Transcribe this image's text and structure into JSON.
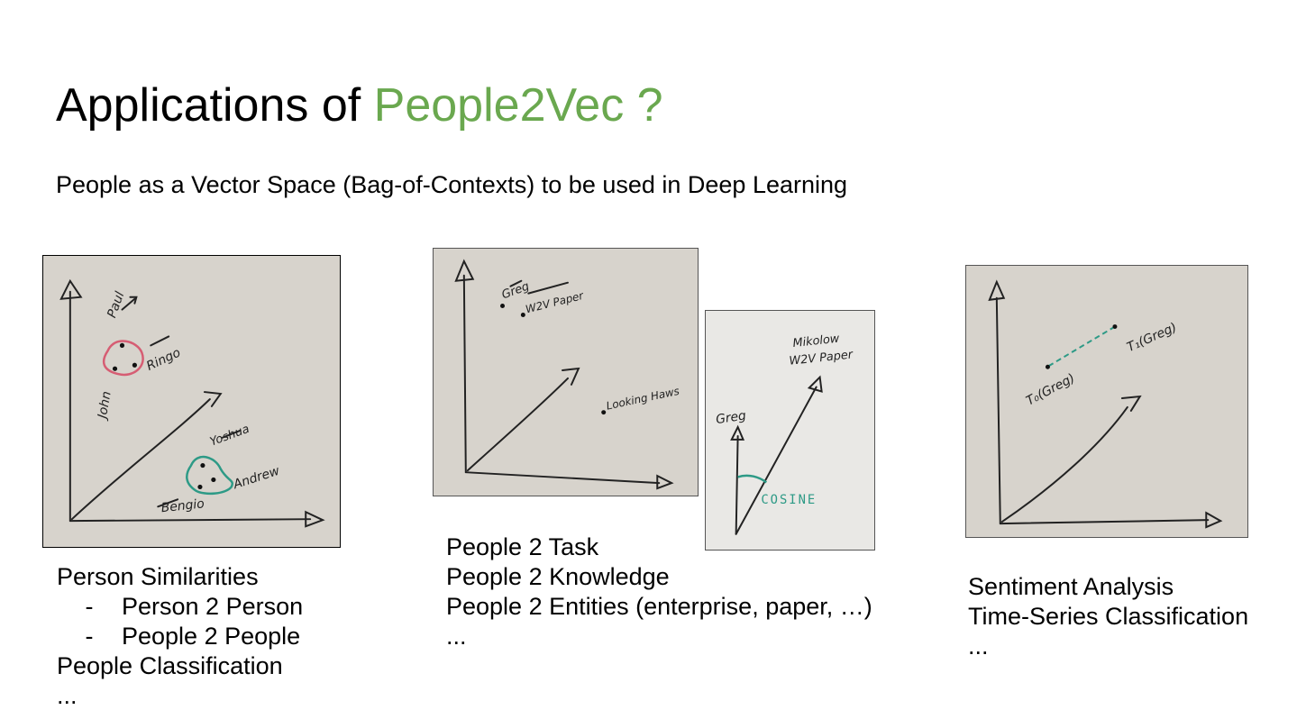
{
  "title": {
    "prefix": "Applications of ",
    "accent": "People2Vec ?"
  },
  "subtitle": "People as a Vector Space (Bag-of-Contexts) to be used in Deep Learning",
  "sketch1": {
    "labels": [
      "Paul",
      "Ringo",
      "John",
      "Yoshua",
      "Andrew",
      "Bengio"
    ]
  },
  "sketch2": {
    "labels": [
      "Greg",
      "W2V Paper",
      "Looking Haws"
    ]
  },
  "sketch3": {
    "labels": [
      "Mikolow",
      "W2V Paper",
      "Greg",
      "COSINE"
    ]
  },
  "sketch4": {
    "labels": [
      "T₁(Greg)",
      "T₀(Greg)"
    ]
  },
  "left_list": {
    "heading": "Person Similarities",
    "sub": [
      {
        "dash": "-",
        "text": "Person 2 Person"
      },
      {
        "dash": "-",
        "text": "People 2 People"
      }
    ],
    "item": "People Classification",
    "ellipsis": "..."
  },
  "middle_list": {
    "items": [
      "People 2 Task",
      "People 2 Knowledge",
      "People 2 Entities (enterprise, paper, …)"
    ],
    "ellipsis": "..."
  },
  "right_list": {
    "items": [
      "Sentiment Analysis",
      "Time-Series Classification"
    ],
    "ellipsis": "..."
  }
}
